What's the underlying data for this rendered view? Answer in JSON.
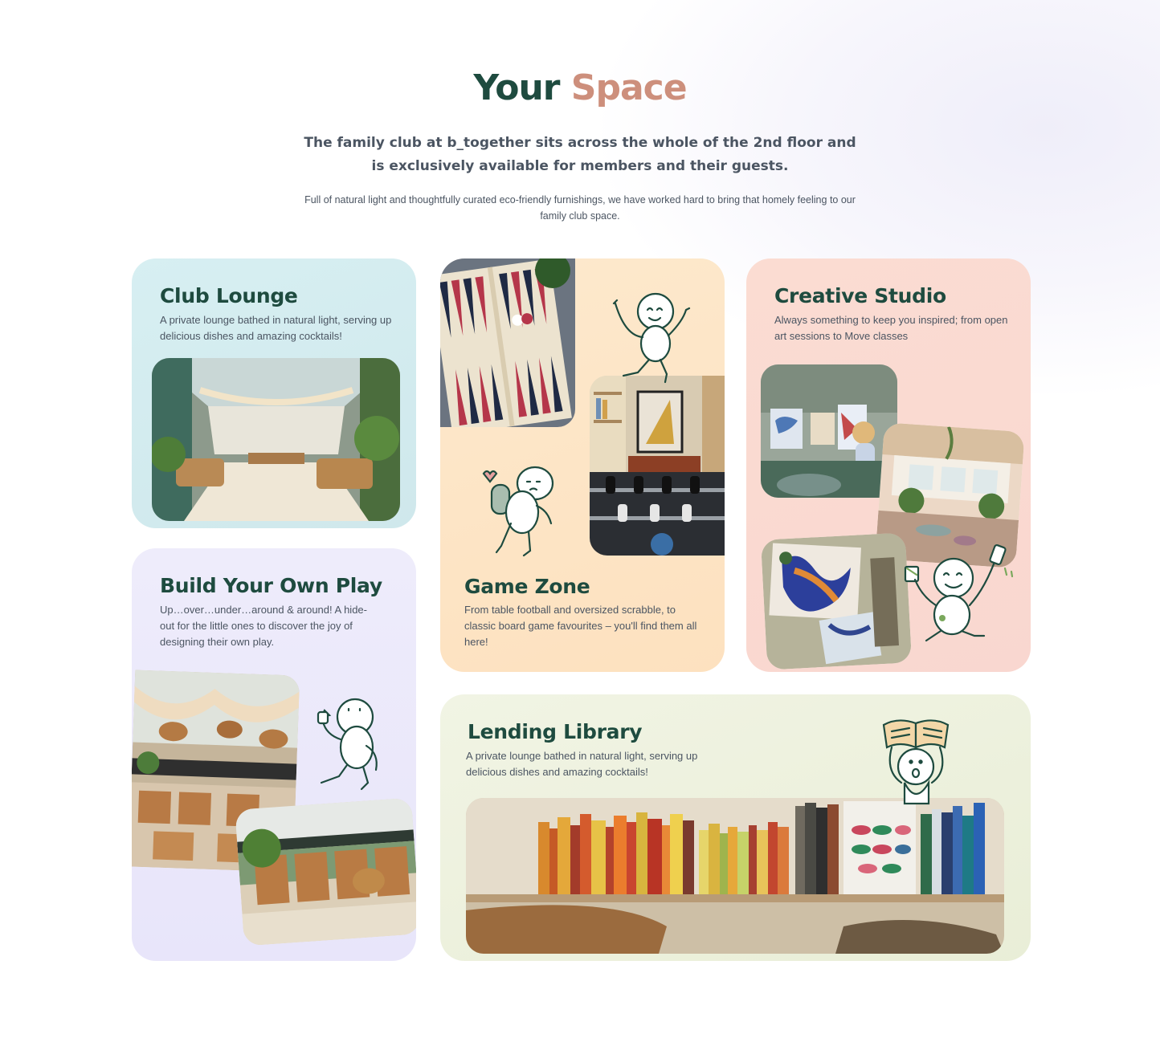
{
  "header": {
    "title_part1": "Your",
    "title_part2": "Space",
    "lead": "The family club at b_together sits across the whole of the 2nd floor and is exclusively available for members and their guests.",
    "sub": "Full of natural light and thoughtfully curated eco-friendly furnishings, we have worked hard to bring that homely feeling to our family club space."
  },
  "cards": {
    "club_lounge": {
      "title": "Club Lounge",
      "desc": "A private lounge bathed in natural light, serving up delicious dishes and amazing cocktails!"
    },
    "game_zone": {
      "title": "Game Zone",
      "desc": "From table football and oversized scrabble, to classic board game favourites – you'll find them all here!"
    },
    "creative_studio": {
      "title": "Creative Studio",
      "desc": "Always something to keep you inspired; from open art sessions to Move classes"
    },
    "build_your_own_play": {
      "title": "Build Your Own Play",
      "desc": "Up…over…under…around & around! A hide-out for the little ones to discover the joy of designing their own play."
    },
    "lending_library": {
      "title": "Lending Library",
      "desc": "A private lounge bathed in natural light, serving up delicious dishes and amazing cocktails!"
    }
  },
  "colors": {
    "title_green": "#1e4b3f",
    "title_accent": "#cd8f7c",
    "club_lounge_bg": "#d4edf0",
    "game_zone_bg": "#fde6c6",
    "creative_studio_bg": "#fadad2",
    "build_play_bg": "#ebe8fb",
    "library_bg": "#eef2e0"
  },
  "icons": [
    "character-doodle-waving",
    "character-doodle-backpack",
    "character-doodle-painting",
    "character-doodle-climbing",
    "character-doodle-book-head"
  ]
}
